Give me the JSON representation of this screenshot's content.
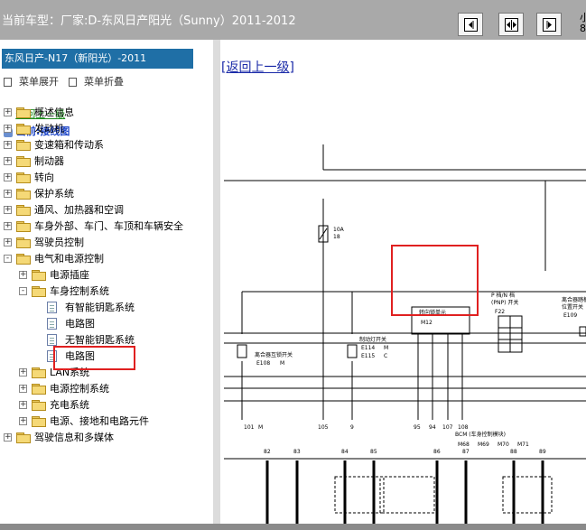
{
  "window": {
    "title": "当前车型：厂家:D-东风日产阳光（Sunny）2011-2012",
    "edge_chars": [
      "小",
      "8"
    ]
  },
  "toolbar": {
    "buttons": [
      {
        "icon": "collapse-left-icon"
      },
      {
        "icon": "split-view-icon"
      },
      {
        "icon": "expand-right-icon"
      }
    ]
  },
  "sidebar": {
    "header": "东风日产-N17（新阳光）-2011",
    "expand_label": "菜单展开",
    "collapse_label": "菜单折叠",
    "back_label": "返回上一级",
    "current_label": "当前:接线图",
    "tree": [
      {
        "label": "概述信息"
      },
      {
        "label": "发动机"
      },
      {
        "label": "变速箱和传动系"
      },
      {
        "label": "制动器"
      },
      {
        "label": "转向"
      },
      {
        "label": "保护系统"
      },
      {
        "label": "通风、加热器和空调"
      },
      {
        "label": "车身外部、车门、车顶和车辆安全"
      },
      {
        "label": "驾驶员控制"
      },
      {
        "label": "电气和电源控制"
      },
      {
        "label": "电源插座"
      },
      {
        "label": "车身控制系统"
      },
      {
        "label": "有智能钥匙系统"
      },
      {
        "label": "电路图"
      },
      {
        "label": "无智能钥匙系统"
      },
      {
        "label": "电路图"
      },
      {
        "label": "LAN系统"
      },
      {
        "label": "电源控制系统"
      },
      {
        "label": "充电系统"
      },
      {
        "label": "电源、接地和电路元件"
      },
      {
        "label": "驾驶信息和多媒体"
      }
    ]
  },
  "content": {
    "back_link": "[返回上一级]",
    "diagram": {
      "fuse_label": "10A",
      "fuse_id": "18",
      "steering_lock_unit": "转向锁单元",
      "steering_lock_conn": "M12",
      "pn_switch": "P 档/N 档",
      "pn_switch2": "(PNP) 开关",
      "pn_conn": "F22",
      "clutch_interlock": "离合器互锁开关",
      "clutch_conn1": "E108",
      "clutch_conn2": "M",
      "brake_switch": "制动灯开关",
      "brake_conn1": "E114",
      "brake_conn2": "E115",
      "clutch_pos": "离合器踏板",
      "clutch_pos2": "位置开关",
      "clutch_pos_conn": "E109",
      "bcm_label": "BCM (车身控制模块)",
      "bcm_conns": [
        "M68",
        "M69",
        "M70",
        "M71"
      ],
      "pins_top": [
        "101",
        "105",
        "9",
        "95",
        "94",
        "107",
        "108"
      ],
      "pins_bottom": [
        "82",
        "83",
        "84",
        "85",
        "86",
        "87",
        "88",
        "89"
      ],
      "m_label": "M",
      "c_label": "C"
    }
  }
}
